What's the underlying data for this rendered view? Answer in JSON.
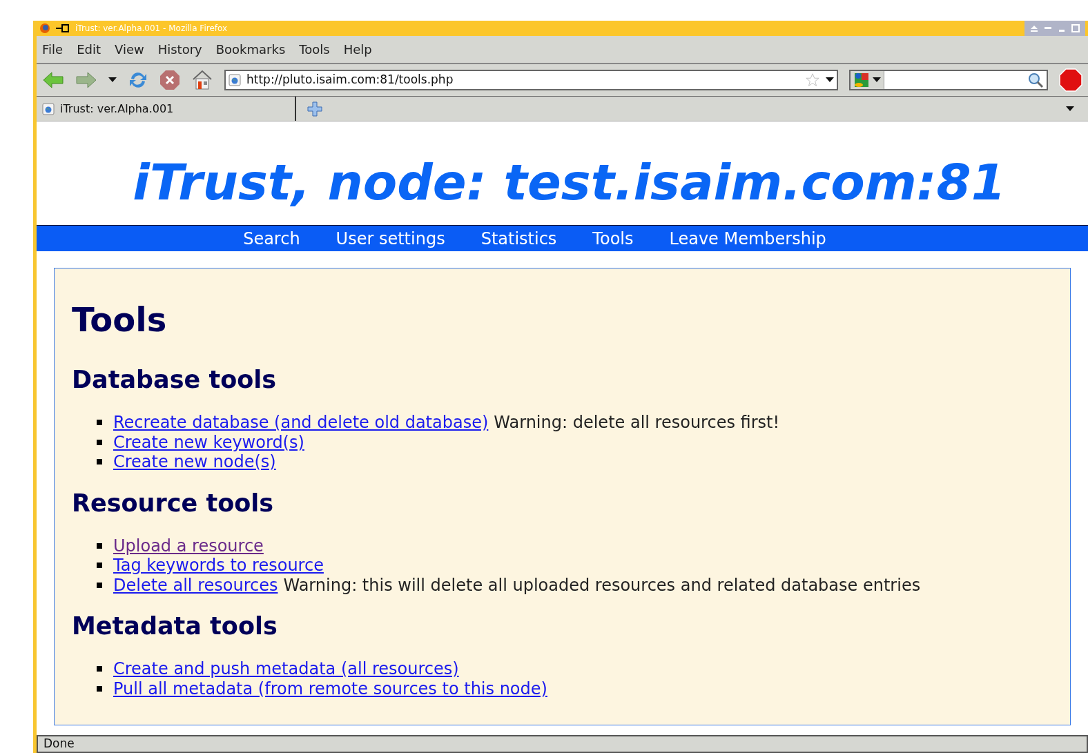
{
  "window": {
    "title": "iTrust: ver.Alpha.001 - Mozilla Firefox"
  },
  "menu": [
    "File",
    "Edit",
    "View",
    "History",
    "Bookmarks",
    "Tools",
    "Help"
  ],
  "address": {
    "value": "http://pluto.isaim.com:81/tools.php"
  },
  "tabs": [
    {
      "label": "iTrust: ver.Alpha.001",
      "selected": true
    }
  ],
  "page": {
    "banner": "iTrust, node: test.isaim.com:81",
    "nav": [
      "Search",
      "User settings",
      "Statistics",
      "Tools",
      "Leave Membership"
    ],
    "heading": "Tools",
    "sections": [
      {
        "title": "Database tools",
        "items": [
          {
            "link": "Recreate database (and delete old database)",
            "visited": false,
            "note": "Warning: delete all resources first!"
          },
          {
            "link": "Create new keyword(s)",
            "visited": false
          },
          {
            "link": "Create new node(s)",
            "visited": false
          }
        ]
      },
      {
        "title": "Resource tools",
        "items": [
          {
            "link": "Upload a resource",
            "visited": true
          },
          {
            "link": "Tag keywords to resource",
            "visited": false
          },
          {
            "link": "Delete all resources",
            "visited": false,
            "note": "Warning: this will delete all uploaded resources and related database entries"
          }
        ]
      },
      {
        "title": "Metadata tools",
        "items": [
          {
            "link": "Create and push metadata (all resources)",
            "visited": false
          },
          {
            "link": "Pull all metadata (from remote sources to this node)",
            "visited": false
          }
        ]
      }
    ]
  },
  "status_bar": "Done"
}
